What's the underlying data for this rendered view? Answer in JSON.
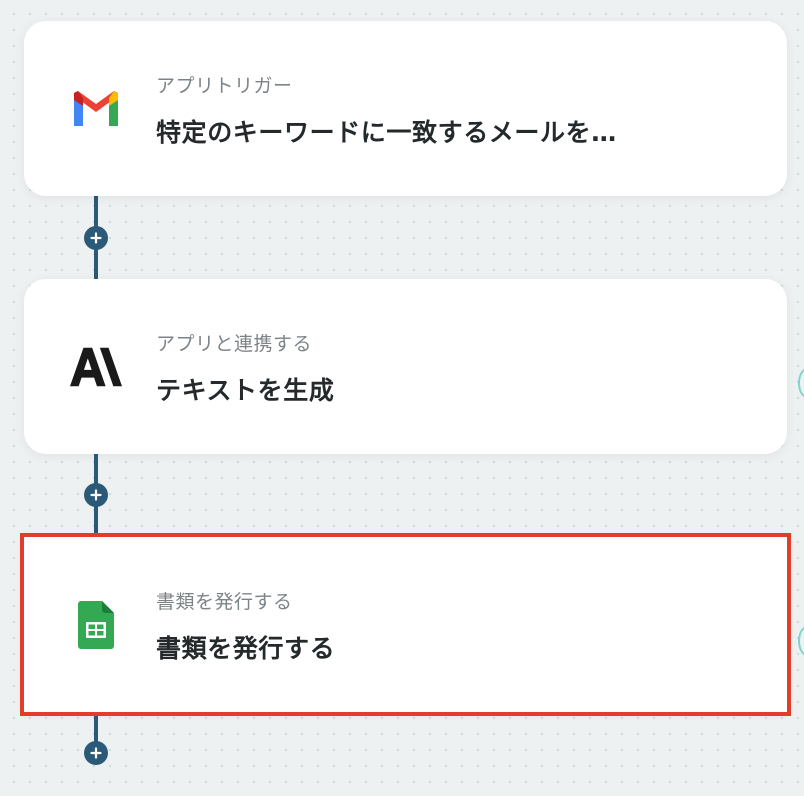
{
  "flow": {
    "steps": [
      {
        "icon": "gmail-icon",
        "subtitle": "アプリトリガー",
        "title": "特定のキーワードに一致するメールを…"
      },
      {
        "icon": "anthropic-icon",
        "subtitle": "アプリと連携する",
        "title": "テキストを生成"
      },
      {
        "icon": "google-sheets-icon",
        "subtitle": "書類を発行する",
        "title": "書類を発行する"
      }
    ]
  },
  "colors": {
    "connector": "#2b5a78",
    "selection_outline": "#e23d2b",
    "card_background": "#ffffff",
    "canvas_background": "#eef1f2"
  }
}
